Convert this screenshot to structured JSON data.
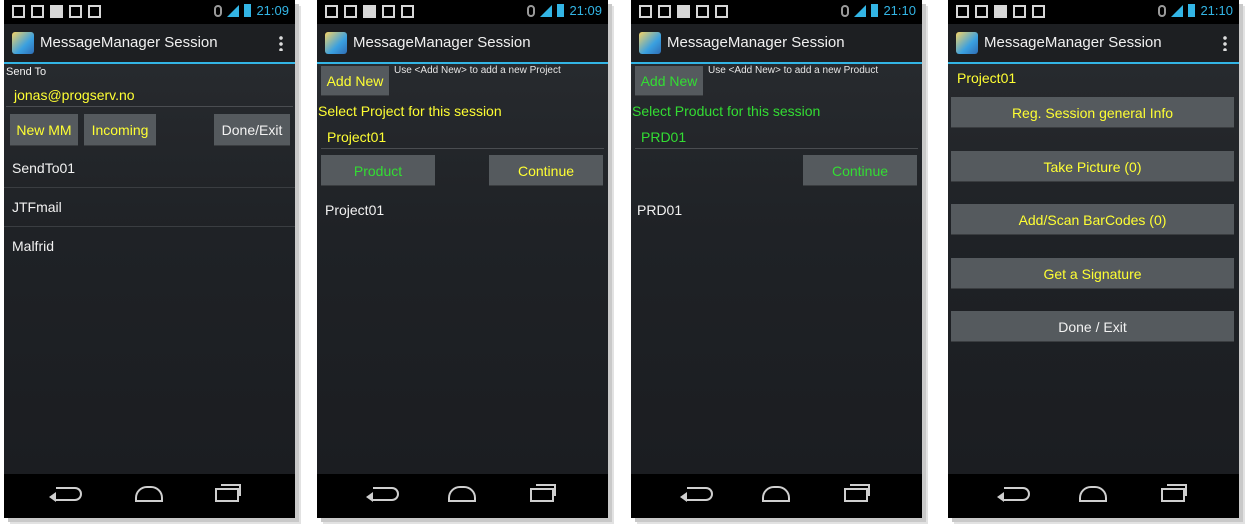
{
  "colors": {
    "accent": "#33b5e5",
    "yellow": "#ffff33",
    "green": "#33dd33",
    "button_bg": "#555a5e"
  },
  "screens": [
    {
      "status_time": "21:09",
      "title": "MessageManager Session",
      "send_to_label": "Send To",
      "email_value": "jonas@progserv.no",
      "buttons": {
        "new_mm": "New MM",
        "incoming": "Incoming",
        "done_exit": "Done/Exit"
      },
      "list": [
        "SendTo01",
        "JTFmail",
        "Malfrid"
      ]
    },
    {
      "status_time": "21:09",
      "title": "MessageManager Session",
      "add_new": "Add New",
      "hint": "Use <Add New> to add a new Project",
      "select_label": "Select Project for this session",
      "selected_value": "Project01",
      "buttons": {
        "product": "Product",
        "continue": "Continue"
      },
      "list": [
        "Project01"
      ]
    },
    {
      "status_time": "21:10",
      "title": "MessageManager Session",
      "add_new": "Add New",
      "hint": "Use <Add New> to add a new Product",
      "select_label": "Select Product for this session",
      "selected_value": "PRD01",
      "buttons": {
        "continue": "Continue"
      },
      "list": [
        "PRD01"
      ]
    },
    {
      "status_time": "21:10",
      "title": "MessageManager Session",
      "project": "Project01",
      "buttons": {
        "reg_info": "Reg. Session general Info",
        "take_picture": "Take Picture (0)",
        "barcodes": "Add/Scan BarCodes (0)",
        "signature": "Get a Signature",
        "done_exit": "Done / Exit"
      }
    }
  ]
}
